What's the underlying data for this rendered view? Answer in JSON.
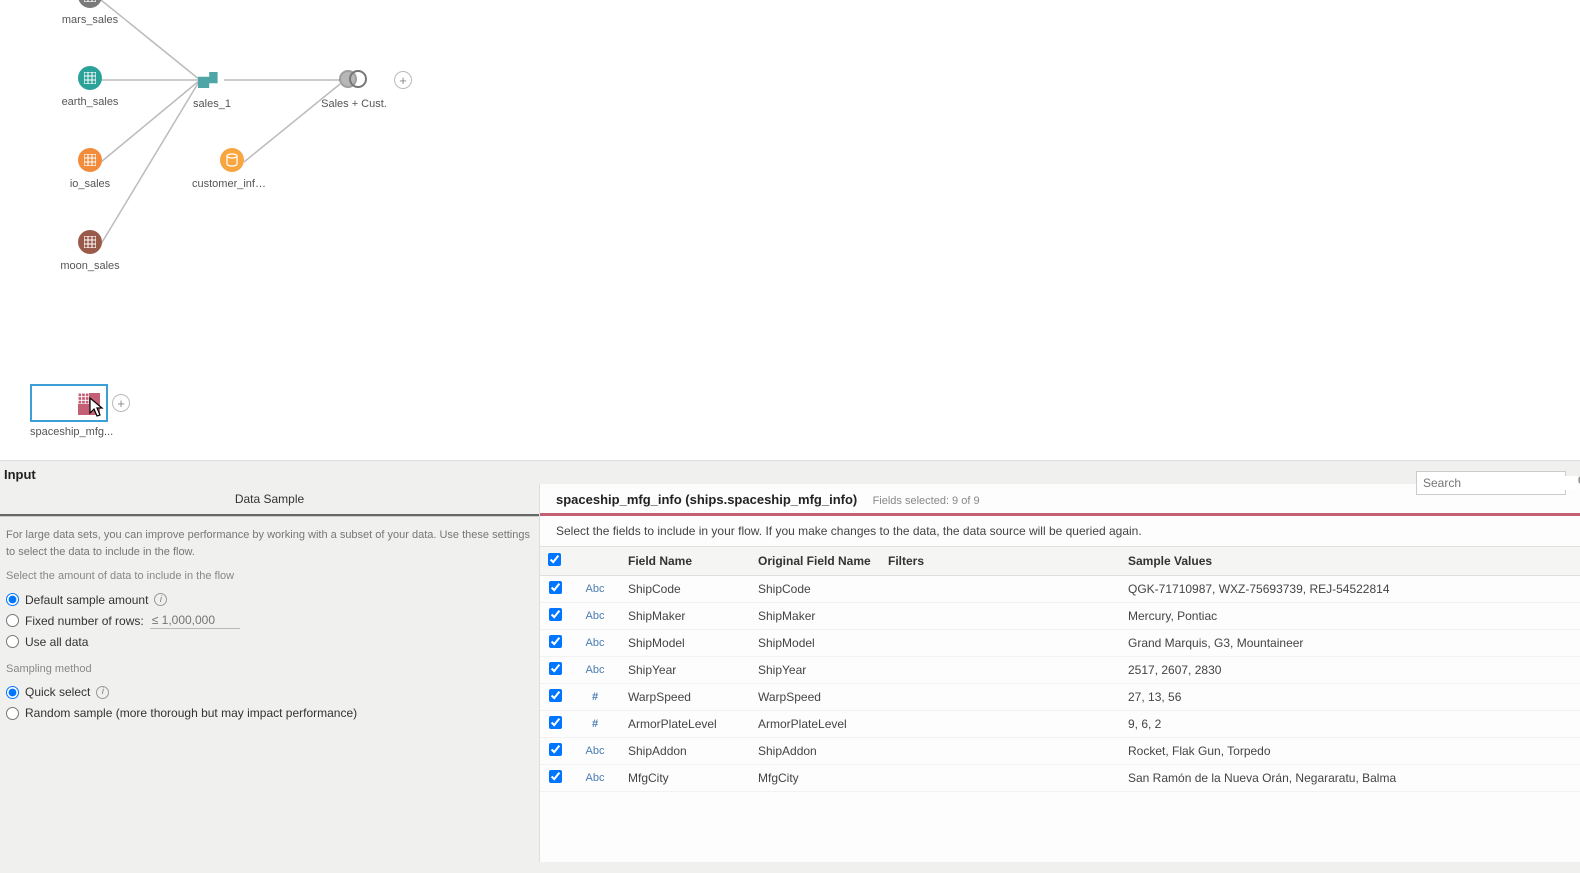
{
  "flow": {
    "nodes": {
      "mars": {
        "label": "mars_sales",
        "color": "#7a7a7a"
      },
      "earth": {
        "label": "earth_sales",
        "color": "#2aa29a"
      },
      "io": {
        "label": "io_sales",
        "color": "#f28c3c"
      },
      "moon": {
        "label": "moon_sales",
        "color": "#9a5a4a"
      },
      "sales1": {
        "label": "sales_1"
      },
      "customer": {
        "label": "customer_info ...",
        "color": "#f7a640"
      },
      "join": {
        "label": "Sales + Cust."
      },
      "spaceship": {
        "label": "spaceship_mfg...",
        "color": "#c36075"
      }
    }
  },
  "panel": {
    "header": "Input",
    "search_placeholder": "Search",
    "tab_label": "Data Sample",
    "hint": "For large data sets, you can improve performance by working with a subset of your data. Use these settings to select the data to include in the flow.",
    "amount_label": "Select the amount of data to include in the flow",
    "opt_default": "Default sample amount",
    "opt_fixed": "Fixed number of rows:",
    "fixed_placeholder": "≤ 1,000,000",
    "opt_all": "Use all data",
    "sampling_label": "Sampling method",
    "opt_quick": "Quick select",
    "opt_random": "Random sample (more thorough but may impact performance)"
  },
  "fields_panel": {
    "title": "spaceship_mfg_info (ships.spaceship_mfg_info)",
    "subtitle": "Fields selected: 9 of 9",
    "desc": "Select the fields to include in your flow. If you make changes to the data, the data source will be queried again.",
    "headers": {
      "check": "",
      "type": "",
      "field": "Field Name",
      "orig": "Original Field Name",
      "filters": "Filters",
      "samples": "Sample Values"
    },
    "rows": [
      {
        "type": "Abc",
        "field": "ShipCode",
        "orig": "ShipCode",
        "filters": "",
        "samples": "QGK-71710987, WXZ-75693739, REJ-54522814"
      },
      {
        "type": "Abc",
        "field": "ShipMaker",
        "orig": "ShipMaker",
        "filters": "",
        "samples": "Mercury, Pontiac"
      },
      {
        "type": "Abc",
        "field": "ShipModel",
        "orig": "ShipModel",
        "filters": "",
        "samples": "Grand Marquis, G3, Mountaineer"
      },
      {
        "type": "Abc",
        "field": "ShipYear",
        "orig": "ShipYear",
        "filters": "",
        "samples": "2517, 2607, 2830"
      },
      {
        "type": "#",
        "field": "WarpSpeed",
        "orig": "WarpSpeed",
        "filters": "",
        "samples": "27, 13, 56"
      },
      {
        "type": "#",
        "field": "ArmorPlateLevel",
        "orig": "ArmorPlateLevel",
        "filters": "",
        "samples": "9, 6, 2"
      },
      {
        "type": "Abc",
        "field": "ShipAddon",
        "orig": "ShipAddon",
        "filters": "",
        "samples": "Rocket, Flak Gun, Torpedo"
      },
      {
        "type": "Abc",
        "field": "MfgCity",
        "orig": "MfgCity",
        "filters": "",
        "samples": "San Ramón de la Nueva Orán, Negararatu, Balma"
      }
    ]
  }
}
